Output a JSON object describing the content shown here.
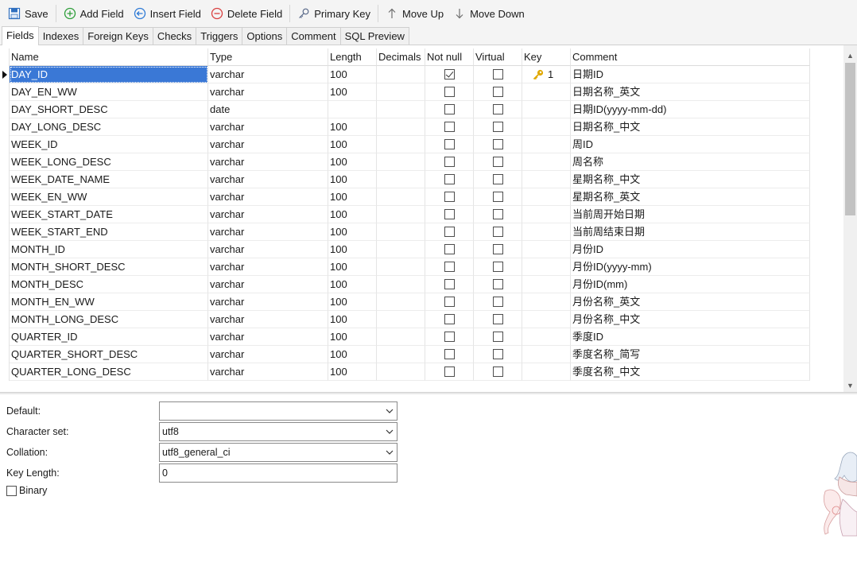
{
  "toolbar": {
    "save": "Save",
    "add_field": "Add Field",
    "insert_field": "Insert Field",
    "delete_field": "Delete Field",
    "primary_key": "Primary Key",
    "move_up": "Move Up",
    "move_down": "Move Down"
  },
  "tabs": [
    {
      "label": "Fields",
      "active": true
    },
    {
      "label": "Indexes"
    },
    {
      "label": "Foreign Keys"
    },
    {
      "label": "Checks"
    },
    {
      "label": "Triggers"
    },
    {
      "label": "Options"
    },
    {
      "label": "Comment"
    },
    {
      "label": "SQL Preview"
    }
  ],
  "grid": {
    "headers": {
      "name": "Name",
      "type": "Type",
      "length": "Length",
      "decimals": "Decimals",
      "not_null": "Not null",
      "virtual": "Virtual",
      "key": "Key",
      "comment": "Comment"
    },
    "rows": [
      {
        "name": "DAY_ID",
        "type": "varchar",
        "length": "100",
        "decimals": "",
        "not_null": true,
        "virtual": false,
        "key": "1",
        "comment": "日期ID",
        "selected": true
      },
      {
        "name": "DAY_EN_WW",
        "type": "varchar",
        "length": "100",
        "decimals": "",
        "not_null": false,
        "virtual": false,
        "key": "",
        "comment": "日期名称_英文"
      },
      {
        "name": "DAY_SHORT_DESC",
        "type": "date",
        "length": "",
        "decimals": "",
        "not_null": false,
        "virtual": false,
        "key": "",
        "comment": "日期ID(yyyy-mm-dd)"
      },
      {
        "name": "DAY_LONG_DESC",
        "type": "varchar",
        "length": "100",
        "decimals": "",
        "not_null": false,
        "virtual": false,
        "key": "",
        "comment": "日期名称_中文"
      },
      {
        "name": "WEEK_ID",
        "type": "varchar",
        "length": "100",
        "decimals": "",
        "not_null": false,
        "virtual": false,
        "key": "",
        "comment": "周ID"
      },
      {
        "name": "WEEK_LONG_DESC",
        "type": "varchar",
        "length": "100",
        "decimals": "",
        "not_null": false,
        "virtual": false,
        "key": "",
        "comment": "周名称"
      },
      {
        "name": "WEEK_DATE_NAME",
        "type": "varchar",
        "length": "100",
        "decimals": "",
        "not_null": false,
        "virtual": false,
        "key": "",
        "comment": "星期名称_中文"
      },
      {
        "name": "WEEK_EN_WW",
        "type": "varchar",
        "length": "100",
        "decimals": "",
        "not_null": false,
        "virtual": false,
        "key": "",
        "comment": "星期名称_英文"
      },
      {
        "name": "WEEK_START_DATE",
        "type": "varchar",
        "length": "100",
        "decimals": "",
        "not_null": false,
        "virtual": false,
        "key": "",
        "comment": "当前周开始日期"
      },
      {
        "name": "WEEK_START_END",
        "type": "varchar",
        "length": "100",
        "decimals": "",
        "not_null": false,
        "virtual": false,
        "key": "",
        "comment": "当前周结束日期"
      },
      {
        "name": "MONTH_ID",
        "type": "varchar",
        "length": "100",
        "decimals": "",
        "not_null": false,
        "virtual": false,
        "key": "",
        "comment": "月份ID"
      },
      {
        "name": "MONTH_SHORT_DESC",
        "type": "varchar",
        "length": "100",
        "decimals": "",
        "not_null": false,
        "virtual": false,
        "key": "",
        "comment": "月份ID(yyyy-mm)"
      },
      {
        "name": "MONTH_DESC",
        "type": "varchar",
        "length": "100",
        "decimals": "",
        "not_null": false,
        "virtual": false,
        "key": "",
        "comment": "月份ID(mm)"
      },
      {
        "name": "MONTH_EN_WW",
        "type": "varchar",
        "length": "100",
        "decimals": "",
        "not_null": false,
        "virtual": false,
        "key": "",
        "comment": "月份名称_英文"
      },
      {
        "name": "MONTH_LONG_DESC",
        "type": "varchar",
        "length": "100",
        "decimals": "",
        "not_null": false,
        "virtual": false,
        "key": "",
        "comment": "月份名称_中文"
      },
      {
        "name": "QUARTER_ID",
        "type": "varchar",
        "length": "100",
        "decimals": "",
        "not_null": false,
        "virtual": false,
        "key": "",
        "comment": "季度ID"
      },
      {
        "name": "QUARTER_SHORT_DESC",
        "type": "varchar",
        "length": "100",
        "decimals": "",
        "not_null": false,
        "virtual": false,
        "key": "",
        "comment": "季度名称_简写"
      },
      {
        "name": "QUARTER_LONG_DESC",
        "type": "varchar",
        "length": "100",
        "decimals": "",
        "not_null": false,
        "virtual": false,
        "key": "",
        "comment": "季度名称_中文"
      }
    ]
  },
  "properties": {
    "default_label": "Default:",
    "default_value": "",
    "charset_label": "Character set:",
    "charset_value": "utf8",
    "collation_label": "Collation:",
    "collation_value": "utf8_general_ci",
    "key_length_label": "Key Length:",
    "key_length_value": "0",
    "binary_label": "Binary",
    "binary_checked": false
  },
  "colors": {
    "selection": "#3a78d6",
    "toolbar_bg": "#f4f4f4",
    "key_icon": "#e0a800",
    "add_icon": "#2e9e3a",
    "insert_icon": "#2f7bd6",
    "delete_icon": "#d94040"
  }
}
